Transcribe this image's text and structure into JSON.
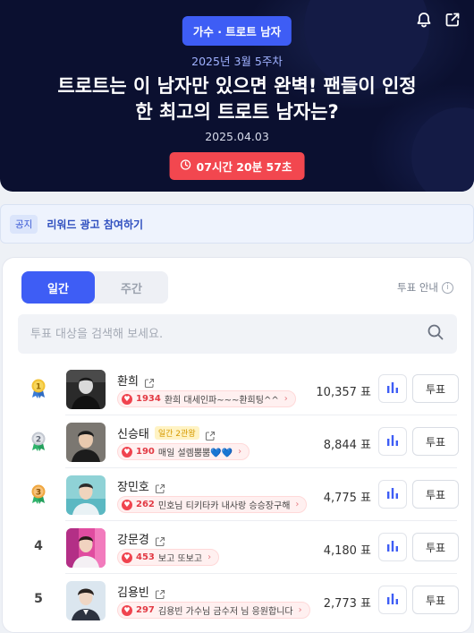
{
  "header": {
    "category": "가수 · 트로트 남자",
    "week": "2025년 3월 5주차",
    "title_line1": "트로트는 이 남자만 있으면 완벽! 팬들이 인정",
    "title_line2": "한 최고의 트로트 남자는?",
    "date": "2025.04.03",
    "timer": "07시간 20분 57초"
  },
  "notice": {
    "tag": "공지",
    "text": "리워드 광고 참여하기"
  },
  "tabs": [
    {
      "label": "일간",
      "active": true
    },
    {
      "label": "주간",
      "active": false
    }
  ],
  "vote_guide": "투표 안내",
  "search": {
    "placeholder": "투표 대상을 검색해 보세요."
  },
  "list": [
    {
      "rank": "1",
      "name": "환희",
      "badge": "",
      "cheer_count": "1934",
      "cheer_msg": "환희 대세인파~~~환희팅^^",
      "votes": "10,357 표",
      "vote_label": "투표"
    },
    {
      "rank": "2",
      "name": "신승태",
      "badge": "일간 2관왕",
      "cheer_count": "190",
      "cheer_msg": "매일 설렘뿜뿜💙💙",
      "votes": "8,844 표",
      "vote_label": "투표"
    },
    {
      "rank": "3",
      "name": "장민호",
      "badge": "",
      "cheer_count": "262",
      "cheer_msg": "민호님 티키타카 내사랑 승승장구해",
      "votes": "4,775 표",
      "vote_label": "투표"
    },
    {
      "rank": "4",
      "name": "강문경",
      "badge": "",
      "cheer_count": "453",
      "cheer_msg": "보고 또보고",
      "votes": "4,180 표",
      "vote_label": "투표"
    },
    {
      "rank": "5",
      "name": "김용빈",
      "badge": "",
      "cheer_count": "297",
      "cheer_msg": "김용빈 가수님 금수저 님 응원합니다",
      "votes": "2,773 표",
      "vote_label": "투표"
    }
  ],
  "colors": {
    "accent": "#3e5df5",
    "timer": "#f2474f",
    "gold": "#f3c232",
    "silver": "#c3c8d1",
    "bronze": "#f0a63e"
  }
}
